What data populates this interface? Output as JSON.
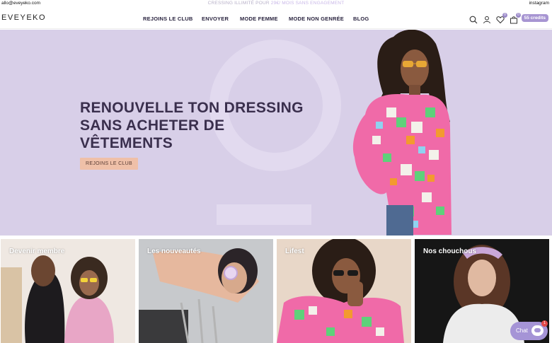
{
  "topbar": {
    "email": "allo@eveyeko.com",
    "promo_text": "CRESSING ILLIMITÉ POUR",
    "promo_highlight": "29€/ MOIS SANS ENGAGEMENT",
    "instagram": "instagram"
  },
  "header": {
    "logo": "EVEYEKO",
    "nav": [
      {
        "label": "REJOINS LE CLUB"
      },
      {
        "label": "ENVOYER"
      },
      {
        "label": "MODE FEMME"
      },
      {
        "label": "MODE NON GENRÉE"
      },
      {
        "label": "BLOG"
      }
    ],
    "wishlist_count": "0",
    "cart_count": "0",
    "credits": "55 credits"
  },
  "hero": {
    "title_line1": "RENOUVELLE TON DRESSING",
    "title_line2": "SANS ACHETER DE",
    "title_line3": "VÊTEMENTS",
    "cta": "REJOINS LE CLUB"
  },
  "tiles": [
    {
      "label": "Devenir membre"
    },
    {
      "label": "Les nouveautés"
    },
    {
      "label": "Lifest"
    },
    {
      "label": "Nos chouchous"
    }
  ],
  "chat": {
    "label": "Chat",
    "badge": "1"
  },
  "colors": {
    "accent": "#a795d2",
    "hero_bg": "#d8cfe8",
    "cta": "#efc0a8"
  }
}
